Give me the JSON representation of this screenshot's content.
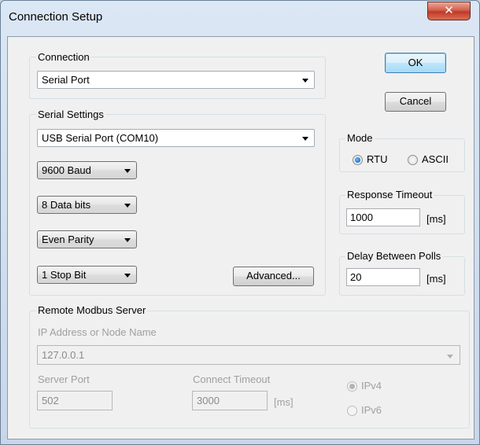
{
  "window": {
    "title": "Connection Setup",
    "close_glyph": "✕"
  },
  "connection": {
    "label": "Connection",
    "value": "Serial Port"
  },
  "serial": {
    "label": "Serial Settings",
    "port": "USB Serial Port (COM10)",
    "baud": "9600 Baud",
    "data_bits": "8 Data bits",
    "parity": "Even Parity",
    "stop_bits": "1 Stop Bit",
    "advanced_label": "Advanced..."
  },
  "buttons": {
    "ok": "OK",
    "cancel": "Cancel"
  },
  "mode": {
    "label": "Mode",
    "rtu": "RTU",
    "ascii": "ASCII",
    "selected": "RTU"
  },
  "response_timeout": {
    "label": "Response Timeout",
    "value": "1000",
    "unit": "[ms]"
  },
  "delay_polls": {
    "label": "Delay Between Polls",
    "value": "20",
    "unit": "[ms]"
  },
  "remote": {
    "label": "Remote Modbus Server",
    "ip_label": "IP Address or Node Name",
    "ip_value": "127.0.0.1",
    "port_label": "Server Port",
    "port_value": "502",
    "timeout_label": "Connect Timeout",
    "timeout_value": "3000",
    "timeout_unit": "[ms]",
    "ipv4": "IPv4",
    "ipv6": "IPv6",
    "ip_selected": "IPv4"
  },
  "colors": {
    "title_bg": "#c9d6e6",
    "dialog_bg": "#f0f0f0",
    "close_red": "#c0392b",
    "radio_blue": "#1a6fd1"
  }
}
